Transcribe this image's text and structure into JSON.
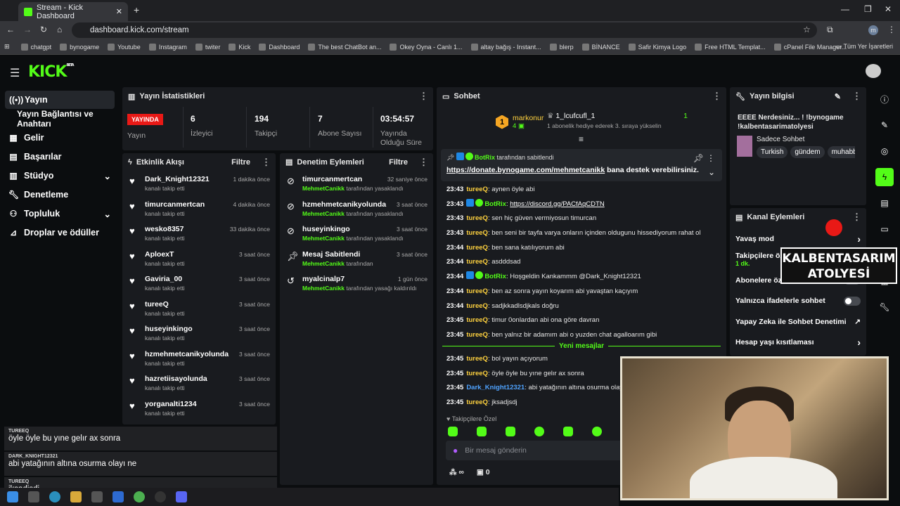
{
  "browser": {
    "tab_title": "Stream - Kick Dashboard",
    "url": "dashboard.kick.com/stream",
    "bookmarks": [
      "chatgpt",
      "bynogame",
      "Youtube",
      "Instagram",
      "twiter",
      "Kick",
      "Dashboard",
      "The best ChatBot an...",
      "Okey Oyna - Canlı 1...",
      "altay bağış - Instant...",
      "blerp",
      "BİNANCE",
      "Safir Kimya Logo",
      "Free HTML Templat...",
      "cPanel File Manager..."
    ],
    "other_bookmarks": "Tüm Yer İşaretleri",
    "profile_initial": "m"
  },
  "brand": {
    "logo": "KICK",
    "beta": "BETA"
  },
  "sidebar": {
    "items": [
      {
        "label": "Yayın",
        "icon": "broadcast-icon"
      },
      {
        "label": "Yayın Bağlantısı ve Anahtarı"
      },
      {
        "label": "Gelir",
        "icon": "revenue-icon"
      },
      {
        "label": "Başarılar",
        "icon": "achievements-icon"
      },
      {
        "label": "Stüdyo",
        "icon": "studio-icon"
      },
      {
        "label": "Denetleme",
        "icon": "wrench-icon"
      },
      {
        "label": "Topluluk",
        "icon": "community-icon"
      },
      {
        "label": "Droplar ve ödüller",
        "icon": "drops-icon"
      }
    ]
  },
  "stats": {
    "title": "Yayın İstatistikleri",
    "live_badge": "YAYINDA",
    "live_label": "Yayın",
    "viewers": {
      "value": "6",
      "label": "İzleyici"
    },
    "followers": {
      "value": "194",
      "label": "Takipçi"
    },
    "subs": {
      "value": "7",
      "label": "Abone Sayısı"
    },
    "uptime": {
      "value": "03:54:57",
      "label": "Yayında Olduğu Süre"
    }
  },
  "activity": {
    "title": "Etkinlik Akışı",
    "filter": "Filtre",
    "items": [
      {
        "name": "Dark_Knight12321",
        "sub": "kanalı takip etti",
        "time": "1 dakika önce"
      },
      {
        "name": "timurcanmertcan",
        "sub": "kanalı takip etti",
        "time": "4 dakika önce"
      },
      {
        "name": "wesko8357",
        "sub": "kanalı takip etti",
        "time": "33 dakika önce"
      },
      {
        "name": "AploexT",
        "sub": "kanalı takip etti",
        "time": "3 saat önce"
      },
      {
        "name": "Gaviria_00",
        "sub": "kanalı takip etti",
        "time": "3 saat önce"
      },
      {
        "name": "tureeQ",
        "sub": "kanalı takip etti",
        "time": "3 saat önce"
      },
      {
        "name": "huseyinkingo",
        "sub": "kanalı takip etti",
        "time": "3 saat önce"
      },
      {
        "name": "hzmehmetcanikyolunda",
        "sub": "kanalı takip etti",
        "time": "3 saat önce"
      },
      {
        "name": "hazretiisayolunda",
        "sub": "kanalı takip etti",
        "time": "3 saat önce"
      },
      {
        "name": "yorganalti1234",
        "sub": "kanalı takip etti",
        "time": "3 saat önce"
      }
    ]
  },
  "moderation": {
    "title": "Denetim Eylemleri",
    "filter": "Filtre",
    "items": [
      {
        "name": "timurcanmertcan",
        "by": "MehmetCanikk",
        "action": "tarafından yasaklandı",
        "time": "32 saniye önce",
        "icon": "ban-icon"
      },
      {
        "name": "hzmehmetcanikyolunda",
        "by": "MehmetCanikk",
        "action": "tarafından yasaklandı",
        "time": "3 saat önce",
        "icon": "ban-icon"
      },
      {
        "name": "huseyinkingo",
        "by": "MehmetCanikk",
        "action": "tarafından yasaklandı",
        "time": "3 saat önce",
        "icon": "ban-icon"
      },
      {
        "name": "Mesaj Sabitlendi",
        "by": "MehmetCanikk",
        "action": "tarafından",
        "time": "3 saat önce",
        "icon": "pin-icon"
      },
      {
        "name": "myalcinalp7",
        "by": "MehmetCanikk",
        "action": "tarafından yasağı kaldırıldı",
        "time": "1 gün önce",
        "icon": "unban-icon"
      }
    ]
  },
  "chat": {
    "title": "Sohbet",
    "top_gifter": {
      "name": "markonur",
      "count": "4",
      "rank": "1"
    },
    "top_event": {
      "name": "1_lcufcufl_1",
      "count": "1",
      "note": "1 abonelik hediye ederek 3. sıraya yükselin"
    },
    "pinned": {
      "by": "BotRix",
      "label": "tarafından sabitlendi",
      "link": "https://donate.bynogame.com/mehmetcanikk",
      "text": " bana destek verebilirsiniz."
    },
    "messages": [
      {
        "time": "23:43",
        "user": "tureeQ",
        "text": "aynen öyle abi",
        "cls": ""
      },
      {
        "time": "23:43",
        "user": "BotRix",
        "text": "https://discord.gg/PACfAqCDTN",
        "cls": "bot",
        "link": true
      },
      {
        "time": "23:43",
        "user": "tureeQ",
        "text": "sen hiç güven vermiyosun timurcan",
        "cls": ""
      },
      {
        "time": "23:43",
        "user": "tureeQ",
        "text": "ben seni bir tayfa varya onların içinden oldugunu hissediyorum rahat ol",
        "cls": ""
      },
      {
        "time": "23:44",
        "user": "tureeQ",
        "text": "ben sana katılıyorum abi",
        "cls": ""
      },
      {
        "time": "23:44",
        "user": "tureeQ",
        "text": "asdddsad",
        "cls": ""
      },
      {
        "time": "23:44",
        "user": "BotRix",
        "text": "Hoşgeldin Kankammm @Dark_Knight12321",
        "cls": "bot"
      },
      {
        "time": "23:44",
        "user": "tureeQ",
        "text": "ben az sonra yayın koyarım abi yavaştan kaçıyım",
        "cls": ""
      },
      {
        "time": "23:44",
        "user": "tureeQ",
        "text": "sadjkkadlsdjkals doğru",
        "cls": ""
      },
      {
        "time": "23:45",
        "user": "tureeQ",
        "text": "timur 0onlardan abi ona göre davran",
        "cls": ""
      },
      {
        "time": "23:45",
        "user": "tureeQ",
        "text": "ben yalnız bir adamım abi o yuzden chat agalloarım gibi",
        "cls": ""
      }
    ],
    "new_messages": "Yeni mesajlar",
    "new": [
      {
        "time": "23:45",
        "user": "tureeQ",
        "text": "bol yayın açıyorum",
        "cls": ""
      },
      {
        "time": "23:45",
        "user": "tureeQ",
        "text": "öyle öyle bu yıne gelır ax sonra",
        "cls": ""
      },
      {
        "time": "23:45",
        "user": "Dark_Knight12321",
        "text": "abi yatağının altına osurma olayı ne",
        "cls": "blue"
      },
      {
        "time": "23:45",
        "user": "tureeQ",
        "text": "jksadjsdj",
        "cls": ""
      }
    ],
    "follower_only": "Takipçilere Özel",
    "input_placeholder": "Bir mesaj gönderin",
    "points": "∞",
    "gifts": "0"
  },
  "stream_info": {
    "title": "Yayın bilgisi",
    "stream_title": "EEEE Nerdesiniz... ! !bynogame !kalbentasarimatolyesi",
    "category": "Sadece Sohbet",
    "tags": [
      "Turkish",
      "gündem",
      "muhabbe"
    ]
  },
  "channel_actions": {
    "title": "Kanal Eylemleri",
    "items": [
      {
        "label": "Yavaş mod",
        "ctl": "chevron"
      },
      {
        "label": "Takipçilere öz",
        "sub": "1 dk.",
        "ctl": "chevron"
      },
      {
        "label": "Abonelere öze",
        "ctl": "toggle"
      },
      {
        "label": "Yalnızca ifadelerle sohbet",
        "ctl": "toggle"
      },
      {
        "label": "Yapay Zeka ile Sohbet Denetimi",
        "ctl": "external"
      },
      {
        "label": "Hesap yaşı kısıtlaması",
        "ctl": "chevron"
      }
    ]
  },
  "overlay": {
    "brand_line1": "KALBENTASARIM",
    "brand_line2": "ATOLYESİ",
    "chat": [
      {
        "name": "TUREEQ",
        "text": "öyle öyle bu yıne gelır ax sonra"
      },
      {
        "name": "DARK_KNIGHT12321",
        "text": "abi yatağının altına osurma olayı ne"
      },
      {
        "name": "TUREEQ",
        "text": "jksadjsdj"
      }
    ]
  },
  "colors": {
    "accent": "#53fc18",
    "panel": "#191b1f",
    "live": "#e91916"
  }
}
